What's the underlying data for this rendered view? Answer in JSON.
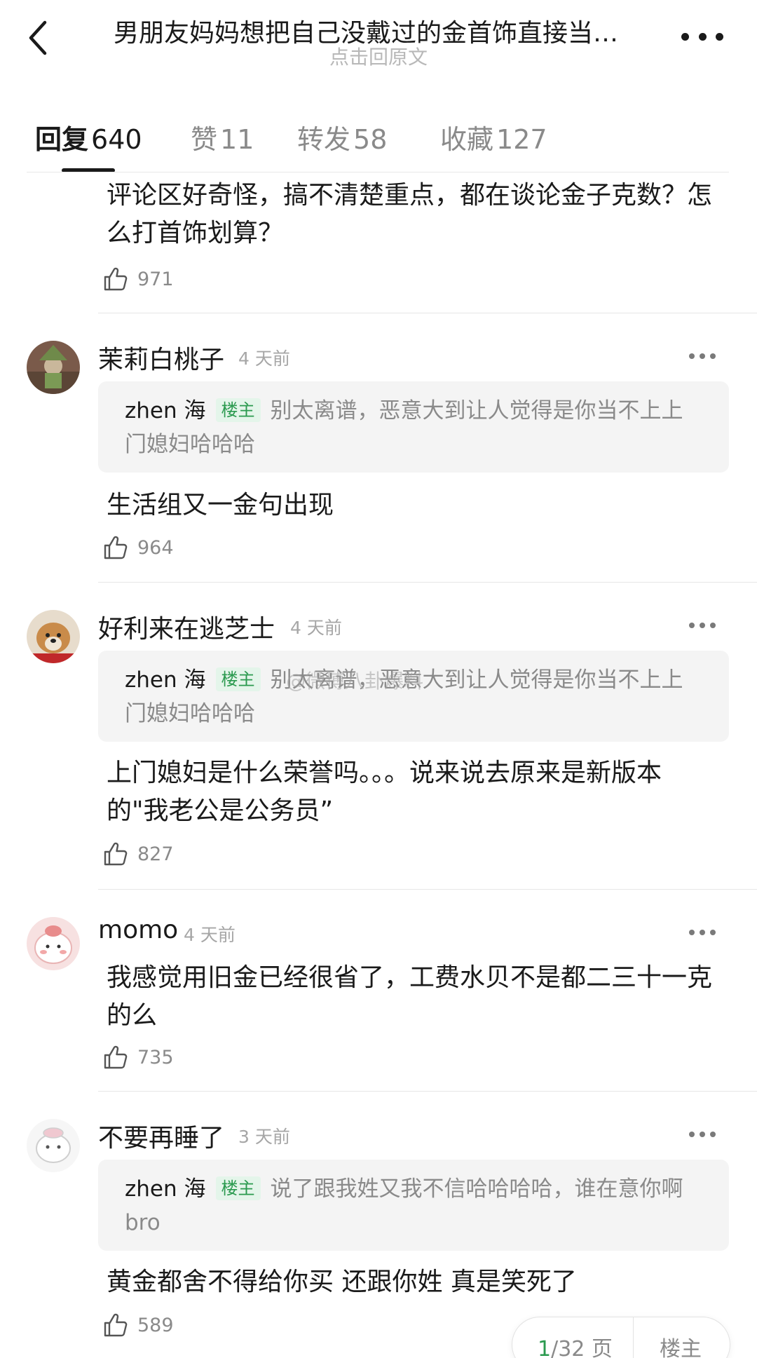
{
  "header": {
    "title": "男朋友妈妈想把自己没戴过的金首饰直接当…",
    "subtitle": "点击回原文",
    "back_icon": "chevron-left-icon",
    "more_icon": "more-horizontal-icon"
  },
  "tabs": [
    {
      "label": "回复",
      "count": "640",
      "active": true
    },
    {
      "label": "赞",
      "count": "11",
      "active": false
    },
    {
      "label": "转发",
      "count": "58",
      "active": false
    },
    {
      "label": "收藏",
      "count": "127",
      "active": false
    }
  ],
  "comments": [
    {
      "body": "评论区好奇怪，搞不清楚重点，都在谈论金子克数？怎么打首饰划算？",
      "likes": "971"
    },
    {
      "username": "茉莉白桃子",
      "time": "4 天前",
      "quote": {
        "name": "zhen 海",
        "badge": "楼主",
        "text": "别太离谱，恶意大到让人觉得是你当不上上门媳妇哈哈哈"
      },
      "body": "生活组又一金句出现",
      "likes": "964"
    },
    {
      "username": "好利来在逃芝士",
      "time": "4 天前",
      "quote": {
        "name": "zhen 海",
        "badge": "楼主",
        "text": "别太离谱，恶意大到让人觉得是你当不上上门媳妇哈哈哈"
      },
      "body": "上门媳妇是什么荣誉吗。。。说来说去原来是新版本的\"我老公是公务员”",
      "likes": "827"
    },
    {
      "username": "momo",
      "time": "4 天前",
      "body": "我感觉用旧金已经很省了，工费水贝不是都二三十一克的么",
      "likes": "735"
    },
    {
      "username": "不要再睡了",
      "time": "3 天前",
      "quote": {
        "name": "zhen 海",
        "badge": "楼主",
        "text": "说了跟我姓又我不信哈哈哈哈，谁在意你啊bro"
      },
      "body": "黄金都舍不得给你买 还跟你姓 真是笑死了",
      "likes": "589"
    }
  ],
  "watermark": "@微博八卦爆料",
  "pager": {
    "current": "1",
    "total_label": "/32 页",
    "louzhu_label": "楼主"
  },
  "colors": {
    "accent_green": "#2b9a4f",
    "badge_bg": "#e4f5ea",
    "quote_bg": "#f4f4f4"
  }
}
